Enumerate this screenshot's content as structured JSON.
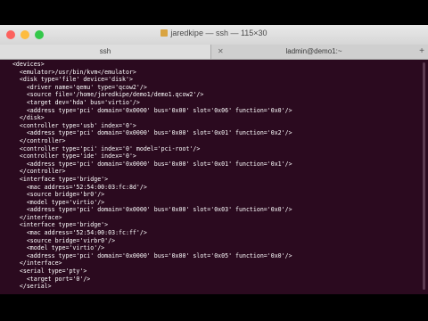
{
  "window": {
    "title": "jaredkipe — ssh — 115×30",
    "traffic_lights": [
      {
        "name": "close",
        "color": "#fc615d"
      },
      {
        "name": "minimize",
        "color": "#fdbc40"
      },
      {
        "name": "zoom",
        "color": "#34c84a"
      }
    ]
  },
  "tabs": [
    {
      "label": "ssh"
    },
    {
      "label": "ladmin@demo1:~"
    }
  ],
  "terminal": {
    "lines": [
      "  <devices>",
      "    <emulator>/usr/bin/kvm</emulator>",
      "    <disk type='file' device='disk'>",
      "      <driver name='qemu' type='qcow2'/>",
      "      <source file='/home/jaredkipe/demo1/demo1.qcow2'/>",
      "      <target dev='hda' bus='virtio'/>",
      "      <address type='pci' domain='0x0000' bus='0x00' slot='0x06' function='0x0'/>",
      "    </disk>",
      "    <controller type='usb' index='0'>",
      "      <address type='pci' domain='0x0000' bus='0x00' slot='0x01' function='0x2'/>",
      "    </controller>",
      "    <controller type='pci' index='0' model='pci-root'/>",
      "    <controller type='ide' index='0'>",
      "      <address type='pci' domain='0x0000' bus='0x00' slot='0x01' function='0x1'/>",
      "    </controller>",
      "    <interface type='bridge'>",
      "      <mac address='52:54:00:03:fc:8d'/>",
      "      <source bridge='br0'/>",
      "      <model type='virtio'/>",
      "      <address type='pci' domain='0x0000' bus='0x00' slot='0x03' function='0x0'/>",
      "    </interface>",
      "    <interface type='bridge'>",
      "      <mac address='52:54:00:03:fc:ff'/>",
      "      <source bridge='virbr0'/>",
      "      <model type='virtio'/>",
      "      <address type='pci' domain='0x0000' bus='0x00' slot='0x05' function='0x0'/>",
      "    </interface>",
      "    <serial type='pty'>",
      "      <target port='0'/>",
      "    </serial>"
    ]
  }
}
